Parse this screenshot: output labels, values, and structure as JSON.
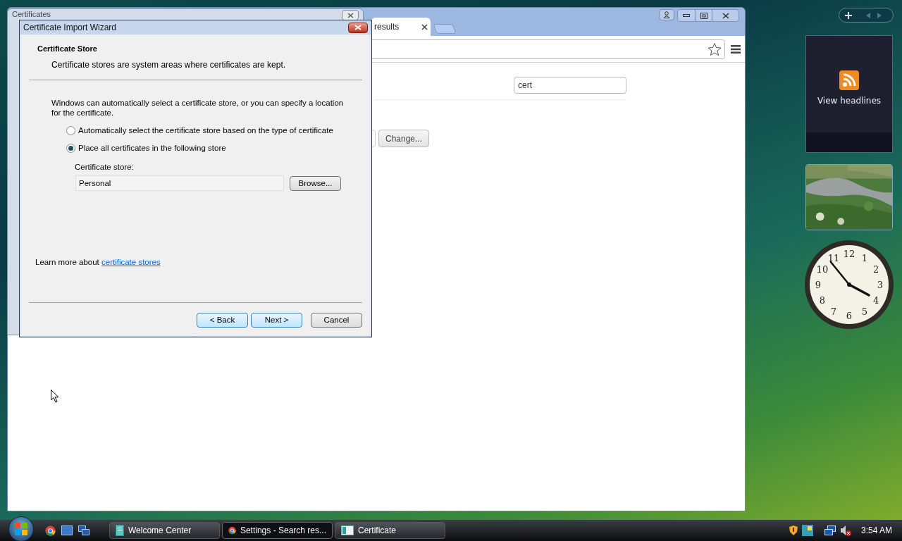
{
  "browser": {
    "tabs": [
      {
        "label": "results",
        "selected": true
      }
    ],
    "search_value": "cert",
    "change_button": "Change..."
  },
  "certificates_window": {
    "title": "Certificates"
  },
  "wizard": {
    "title": "Certificate Import Wizard",
    "heading": "Certificate Store",
    "subheading": "Certificate stores are system areas where certificates are kept.",
    "intro": "Windows can automatically select a certificate store, or you can specify a location for the certificate.",
    "options": [
      {
        "label": "Automatically select the certificate store based on the type of certificate",
        "selected": false
      },
      {
        "label": "Place all certificates in the following store",
        "selected": true
      }
    ],
    "store_label": "Certificate store:",
    "store_value": "Personal",
    "browse_button": "Browse...",
    "learn_more": {
      "text": "Learn more about",
      "link": "certificate stores"
    },
    "buttons": [
      {
        "label": "< Back",
        "highlighted": true
      },
      {
        "label": "Next >",
        "highlighted": true
      },
      {
        "label": "Cancel",
        "highlighted": false
      }
    ]
  },
  "gadgets": {
    "feed": {
      "label": "View headlines"
    },
    "clock": {
      "numerals": [
        "12",
        "11",
        "1",
        "10",
        "2",
        "9",
        "3",
        "8",
        "4",
        "7",
        "5",
        "6"
      ]
    }
  },
  "taskbar": {
    "buttons": [
      {
        "label": "Welcome Center",
        "kind": "document",
        "selected": false
      },
      {
        "label": "Settings - Search res...",
        "kind": "browser",
        "selected": true
      },
      {
        "label": "Certificate",
        "kind": "certificate",
        "selected": false
      }
    ],
    "time": "3:54 AM"
  }
}
